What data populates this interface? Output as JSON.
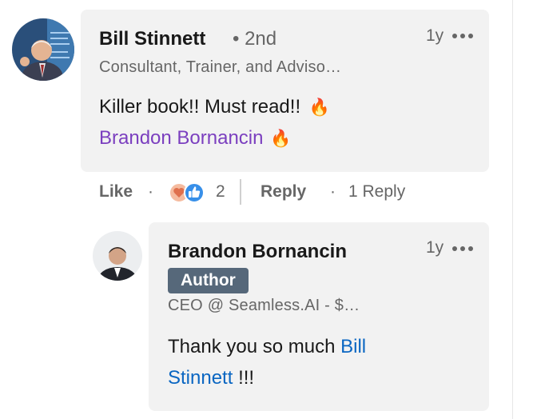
{
  "comment": {
    "author_name": "Bill Stinnett",
    "connection_degree": "• 2nd",
    "headline": "Consultant, Trainer, and Adviso…",
    "age": "1y",
    "line1": "Killer book!! Must read!!",
    "mention": "Brandon Bornancin",
    "fire_emoji": "🔥",
    "actions": {
      "like_label": "Like",
      "dot": "·",
      "reaction_count": "2",
      "reply_label": "Reply",
      "reply_count_label": "1 Reply"
    }
  },
  "reply": {
    "author_name": "Brandon Bornancin",
    "badge": "Author",
    "headline": "CEO @ Seamless.AI - $…",
    "age": "1y",
    "text_before": "Thank you so much",
    "mention_part1": "Bill",
    "mention_part2": "Stinnett",
    "text_after": "!!!"
  },
  "colors": {
    "bubble_bg": "#f2f2f2",
    "mention_blue": "#0a66c2",
    "mention_purple": "#7b3fbf",
    "badge_bg": "#56687a",
    "muted_text": "#666666"
  }
}
